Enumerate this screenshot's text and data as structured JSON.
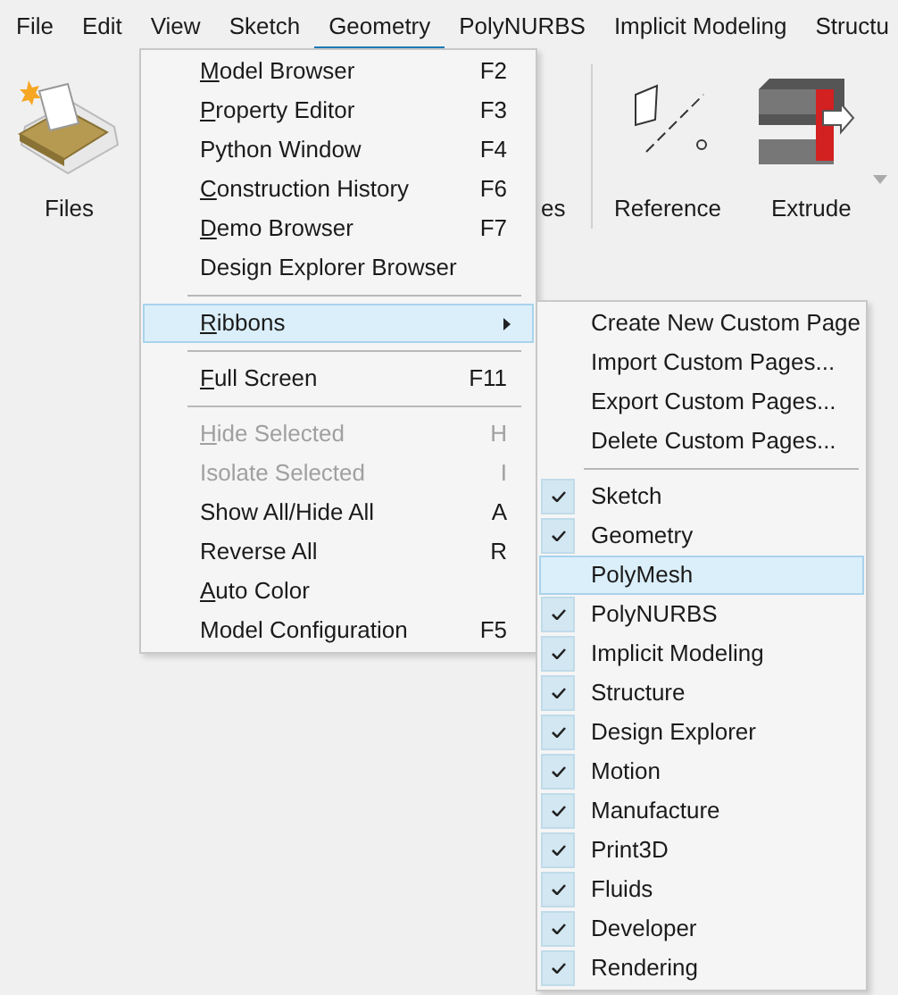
{
  "menubar": [
    {
      "label": "File",
      "selected": false
    },
    {
      "label": "Edit",
      "selected": false
    },
    {
      "label": "View",
      "selected": false
    },
    {
      "label": "Sketch",
      "selected": false
    },
    {
      "label": "Geometry",
      "selected": true
    },
    {
      "label": "PolyNURBS",
      "selected": false
    },
    {
      "label": "Implicit Modeling",
      "selected": false
    },
    {
      "label": "Structu",
      "selected": false
    }
  ],
  "ribbon": {
    "tools": [
      {
        "kind": "files",
        "label": "Files"
      },
      {
        "kind": "hidden",
        "label": "es"
      },
      {
        "kind": "reference",
        "label": "Reference"
      },
      {
        "kind": "extrude",
        "label": "Extrude"
      }
    ]
  },
  "geometry_menu": {
    "items": [
      {
        "kind": "item",
        "label": "Model Browser",
        "shortcut": "F2",
        "mnemonic": true,
        "disabled": false,
        "selected": false,
        "submenu": false
      },
      {
        "kind": "item",
        "label": "Property Editor",
        "shortcut": "F3",
        "mnemonic": true,
        "disabled": false,
        "selected": false,
        "submenu": false
      },
      {
        "kind": "item",
        "label": "Python Window",
        "shortcut": "F4",
        "mnemonic": false,
        "disabled": false,
        "selected": false,
        "submenu": false
      },
      {
        "kind": "item",
        "label": "Construction History",
        "shortcut": "F6",
        "mnemonic": true,
        "disabled": false,
        "selected": false,
        "submenu": false
      },
      {
        "kind": "item",
        "label": "Demo Browser",
        "shortcut": "F7",
        "mnemonic": true,
        "disabled": false,
        "selected": false,
        "submenu": false
      },
      {
        "kind": "item",
        "label": "Design Explorer Browser",
        "mnemonic": false,
        "disabled": false,
        "selected": false,
        "submenu": false
      },
      {
        "kind": "separator"
      },
      {
        "kind": "item",
        "label": "Ribbons",
        "mnemonic": true,
        "disabled": false,
        "selected": true,
        "submenu": true
      },
      {
        "kind": "separator"
      },
      {
        "kind": "item",
        "label": "Full Screen",
        "shortcut": "F11",
        "mnemonic": true,
        "disabled": false,
        "selected": false,
        "submenu": false
      },
      {
        "kind": "separator"
      },
      {
        "kind": "item",
        "label": "Hide Selected",
        "shortcut": "H",
        "mnemonic": true,
        "disabled": true,
        "selected": false,
        "submenu": false
      },
      {
        "kind": "item",
        "label": "Isolate Selected",
        "shortcut": "I",
        "mnemonic": false,
        "disabled": true,
        "selected": false,
        "submenu": false
      },
      {
        "kind": "item",
        "label": "Show All/Hide All",
        "shortcut": "A",
        "mnemonic": false,
        "disabled": false,
        "selected": false,
        "submenu": false
      },
      {
        "kind": "item",
        "label": "Reverse All",
        "shortcut": "R",
        "mnemonic": false,
        "disabled": false,
        "selected": false,
        "submenu": false
      },
      {
        "kind": "item",
        "label": "Auto Color",
        "mnemonic": true,
        "disabled": false,
        "selected": false,
        "submenu": false
      },
      {
        "kind": "item",
        "label": "Model Configuration",
        "shortcut": "F5",
        "mnemonic": false,
        "disabled": false,
        "selected": false,
        "submenu": false
      }
    ]
  },
  "ribbons_submenu": {
    "items": [
      {
        "kind": "command",
        "label": "Create New Custom Page"
      },
      {
        "kind": "command",
        "label": "Import Custom Pages..."
      },
      {
        "kind": "command",
        "label": "Export Custom Pages..."
      },
      {
        "kind": "command",
        "label": "Delete Custom Pages..."
      },
      {
        "kind": "separator"
      },
      {
        "kind": "toggle",
        "label": "Sketch",
        "checked": true,
        "selected": false
      },
      {
        "kind": "toggle",
        "label": "Geometry",
        "checked": true,
        "selected": false
      },
      {
        "kind": "toggle",
        "label": "PolyMesh",
        "checked": false,
        "selected": true
      },
      {
        "kind": "toggle",
        "label": "PolyNURBS",
        "checked": true,
        "selected": false
      },
      {
        "kind": "toggle",
        "label": "Implicit Modeling",
        "checked": true,
        "selected": false
      },
      {
        "kind": "toggle",
        "label": "Structure",
        "checked": true,
        "selected": false
      },
      {
        "kind": "toggle",
        "label": "Design Explorer",
        "checked": true,
        "selected": false
      },
      {
        "kind": "toggle",
        "label": "Motion",
        "checked": true,
        "selected": false
      },
      {
        "kind": "toggle",
        "label": "Manufacture",
        "checked": true,
        "selected": false
      },
      {
        "kind": "toggle",
        "label": "Print3D",
        "checked": true,
        "selected": false
      },
      {
        "kind": "toggle",
        "label": "Fluids",
        "checked": true,
        "selected": false
      },
      {
        "kind": "toggle",
        "label": "Developer",
        "checked": true,
        "selected": false
      },
      {
        "kind": "toggle",
        "label": "Rendering",
        "checked": true,
        "selected": false
      }
    ]
  }
}
